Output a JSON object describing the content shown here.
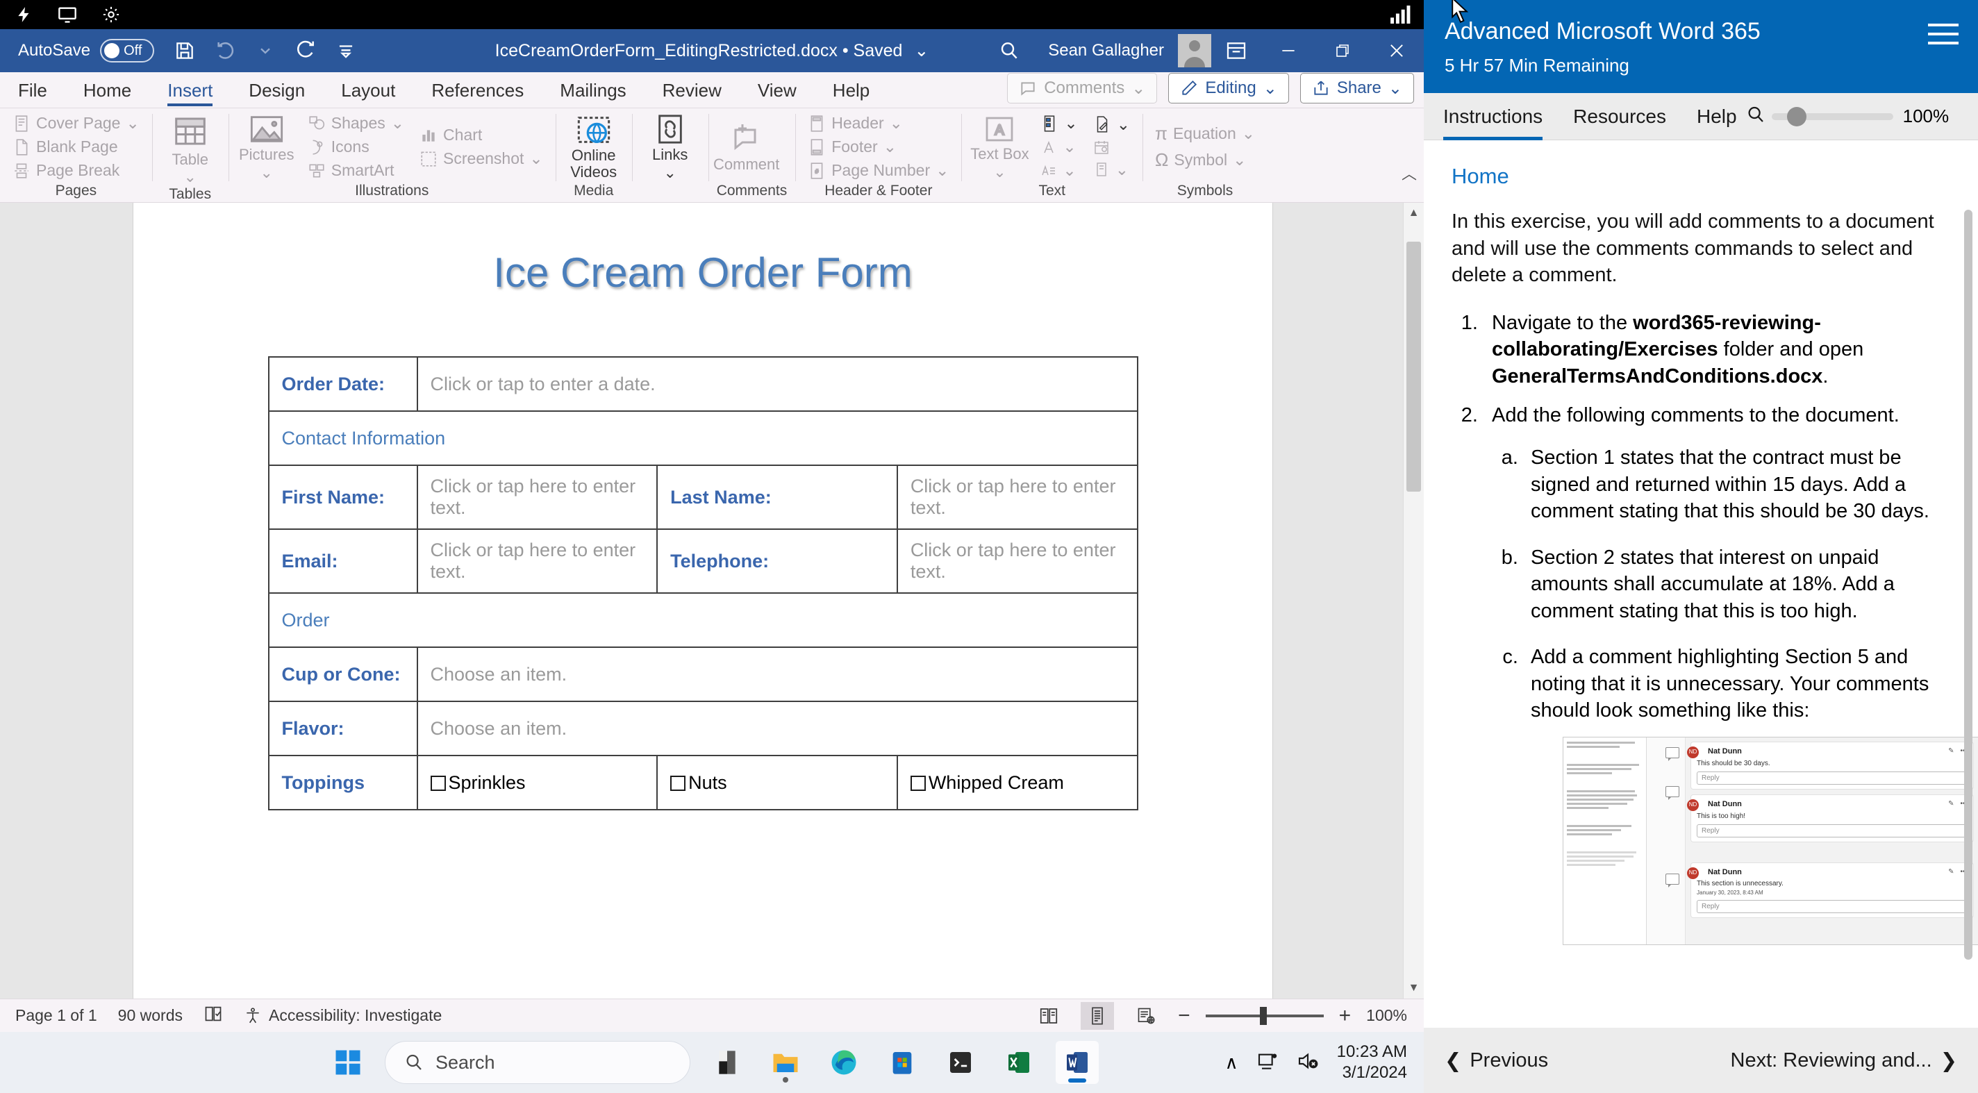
{
  "vm_bar": {
    "icons": [
      "power-icon",
      "display-icon",
      "settings-gear-icon",
      "signal-icon"
    ]
  },
  "word": {
    "titlebar": {
      "autosave_label": "AutoSave",
      "autosave_state": "Off",
      "document_title": "IceCreamOrderForm_EditingRestricted.docx • Saved",
      "user_name": "Sean Gallagher",
      "quick_access": [
        "save-icon",
        "undo-icon",
        "redo-icon",
        "customize-icon"
      ],
      "window_controls": [
        "minimize",
        "restore",
        "close"
      ]
    },
    "tabs": [
      {
        "label": "File",
        "active": false
      },
      {
        "label": "Home",
        "active": false
      },
      {
        "label": "Insert",
        "active": true
      },
      {
        "label": "Design",
        "active": false
      },
      {
        "label": "Layout",
        "active": false
      },
      {
        "label": "References",
        "active": false
      },
      {
        "label": "Mailings",
        "active": false
      },
      {
        "label": "Review",
        "active": false
      },
      {
        "label": "View",
        "active": false
      },
      {
        "label": "Help",
        "active": false
      }
    ],
    "tab_buttons": {
      "comments": "Comments",
      "editing": "Editing",
      "share": "Share"
    },
    "ribbon_groups": [
      {
        "label": "Pages",
        "items": [
          "Cover Page",
          "Blank Page",
          "Page Break"
        ]
      },
      {
        "label": "Tables",
        "items": [
          "Table"
        ]
      },
      {
        "label": "Illustrations",
        "items": [
          "Pictures",
          "Shapes",
          "Icons",
          "SmartArt",
          "Chart",
          "Screenshot"
        ]
      },
      {
        "label": "Media",
        "items": [
          "Online Videos"
        ]
      },
      {
        "label": "Comments",
        "items": [
          "Comment"
        ]
      },
      {
        "label": "Header & Footer",
        "items": [
          "Header",
          "Footer",
          "Page Number"
        ]
      },
      {
        "label": "Text",
        "items": [
          "Text Box"
        ]
      },
      {
        "label": "Symbols",
        "items": [
          "Equation",
          "Symbol"
        ]
      }
    ],
    "document": {
      "heading": "Ice Cream Order Form",
      "rows": [
        {
          "type": "field",
          "label": "Order Date:",
          "value": "Click or tap to enter a date."
        },
        {
          "type": "section",
          "label": "Contact Information"
        },
        {
          "type": "pair",
          "label1": "First Name:",
          "value1": "Click or tap here to enter text.",
          "label2": "Last Name:",
          "value2": "Click or tap here to enter text."
        },
        {
          "type": "pair",
          "label1": "Email:",
          "value1": "Click or tap here to enter text.",
          "label2": "Telephone:",
          "value2": "Click or tap here to enter text."
        },
        {
          "type": "section",
          "label": "Order"
        },
        {
          "type": "field",
          "label": "Cup or Cone:",
          "value": "Choose an item."
        },
        {
          "type": "field",
          "label": "Flavor:",
          "value": "Choose an item."
        },
        {
          "type": "toppings",
          "label": "Toppings",
          "options": [
            "Sprinkles",
            "Nuts",
            "Whipped Cream"
          ]
        }
      ]
    },
    "statusbar": {
      "page": "Page 1 of 1",
      "words": "90 words",
      "accessibility": "Accessibility: Investigate",
      "zoom": "100%",
      "views": [
        "read-mode-icon",
        "print-layout-icon",
        "web-layout-icon"
      ]
    }
  },
  "panel": {
    "title": "Advanced Microsoft Word 365",
    "subtitle": "5 Hr 57 Min Remaining",
    "tabs": [
      {
        "label": "Instructions",
        "active": true
      },
      {
        "label": "Resources",
        "active": false
      },
      {
        "label": "Help",
        "active": false
      }
    ],
    "zoom_value": "100%",
    "home_link": "Home",
    "intro": "In this exercise, you will add comments to a document and will use the comments commands to select and delete a comment.",
    "steps": [
      {
        "text_parts": [
          {
            "t": "Navigate to the ",
            "b": false
          },
          {
            "t": "word365-reviewing-collaborating/Exercises",
            "b": true
          },
          {
            "t": " folder and open ",
            "b": false
          },
          {
            "t": "GeneralTermsAndConditions.docx",
            "b": true
          },
          {
            "t": ".",
            "b": false
          }
        ]
      },
      {
        "text_parts": [
          {
            "t": "Add the following comments to the document.",
            "b": false
          }
        ],
        "substeps": [
          "Section 1 states that the contract must be signed and returned within 15 days. Add a comment stating that this should be 30 days.",
          "Section 2 states that interest on unpaid amounts shall accumulate at 18%. Add a comment stating that this is too high.",
          "Add a comment highlighting Section 5 and noting that it is unnecessary. Your comments should look something like this:"
        ]
      }
    ],
    "thumbnail": {
      "comments": [
        {
          "initials": "ND",
          "author": "Nat Dunn",
          "text": "This should be 30 days.",
          "date": "",
          "reply": "Reply"
        },
        {
          "initials": "ND",
          "author": "Nat Dunn",
          "text": "This is too high!",
          "date": "",
          "reply": "Reply"
        },
        {
          "initials": "ND",
          "author": "Nat Dunn",
          "text": "This section is unnecessary.",
          "date": "January 30, 2023, 8:43 AM",
          "reply": "Reply"
        }
      ]
    },
    "footer": {
      "previous": "Previous",
      "next": "Next: Reviewing and..."
    }
  },
  "taskbar": {
    "search_placeholder": "Search",
    "apps": [
      "start-icon",
      "file-explorer-dark-icon",
      "folder-icon",
      "edge-icon",
      "store-icon",
      "terminal-icon",
      "excel-icon",
      "word-icon"
    ],
    "time": "10:23 AM",
    "date": "3/1/2024"
  },
  "colors": {
    "word_blue": "#2b579a",
    "panel_blue": "#0366b4",
    "heading_blue": "#4a7ebb",
    "label_blue": "#3a66ad",
    "avatar_red": "#c0392b"
  }
}
